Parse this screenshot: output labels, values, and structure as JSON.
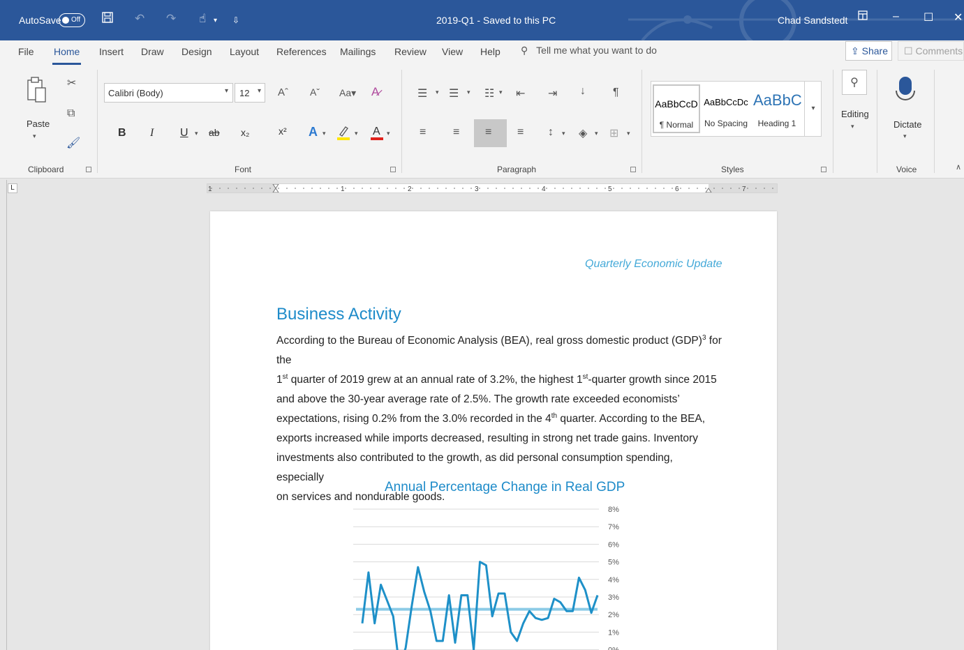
{
  "titlebar": {
    "autosave_label": "AutoSave",
    "autosave_state": "Off",
    "doc_title": "2019-Q1 - Saved to this PC",
    "user_name": "Chad Sandstedt",
    "icons": [
      "save-icon",
      "undo-icon",
      "redo-icon",
      "touch-mode-icon",
      "customize-qat-icon",
      "ribbon-display-icon",
      "minimize-icon",
      "restore-icon",
      "close-icon"
    ]
  },
  "tabs": [
    "File",
    "Home",
    "Insert",
    "Draw",
    "Design",
    "Layout",
    "References",
    "Mailings",
    "Review",
    "View",
    "Help"
  ],
  "active_tab": "Home",
  "tellme": "Tell me what you want to do",
  "share_label": "Share",
  "comments_label": "Comments",
  "ribbon": {
    "clipboard": {
      "label": "Clipboard",
      "paste_label": "Paste"
    },
    "font": {
      "label": "Font",
      "font_name": "Calibri (Body)",
      "font_size": "12",
      "change_case": "Aa"
    },
    "paragraph": {
      "label": "Paragraph"
    },
    "styles": {
      "label": "Styles",
      "items": [
        {
          "preview": "AaBbCcD",
          "name": "¶ Normal"
        },
        {
          "preview": "AaBbCcDc",
          "name": "No Spacing"
        },
        {
          "preview": "AaBbC",
          "name": "Heading 1"
        }
      ]
    },
    "editing": {
      "label": "Editing"
    },
    "voice": {
      "label": "Voice",
      "dictate_label": "Dictate"
    }
  },
  "ruler": {
    "numbers": [
      "1",
      "1",
      "2",
      "3",
      "4",
      "5",
      "6",
      "7"
    ]
  },
  "document": {
    "header_text": "Quarterly Economic Update",
    "heading": "Business Activity",
    "lines": [
      [
        "According to the Bureau of Economic Analysis (BEA), real gross domestic product (GDP)",
        "3",
        " for the"
      ],
      [
        "1",
        "st",
        " quarter of 2019 grew at an annual rate of 3.2%, the highest 1",
        "st",
        "-quarter growth since 2015"
      ],
      [
        "and above the 30-year average rate of 2.5%. The growth rate exceeded economists’"
      ],
      [
        "expectations, rising 0.2% from the 3.0% recorded in the 4",
        "th",
        " quarter. According to the BEA,"
      ],
      [
        "exports increased while imports decreased, resulting in strong net trade gains. Inventory"
      ],
      [
        "investments also contributed to the growth, as did personal consumption spending, especially"
      ],
      [
        "on services and nondurable goods."
      ]
    ],
    "chart_title": "Annual Percentage Change in Real GDP"
  },
  "chart_data": {
    "type": "line",
    "title": "Annual Percentage Change in Real GDP",
    "y_ticks": [
      "8%",
      "7%",
      "6%",
      "5%",
      "4%",
      "3%",
      "2%",
      "1%",
      "0%"
    ],
    "ylim": [
      0,
      8
    ],
    "series": [
      {
        "values": [
          1.5,
          4.4,
          1.5,
          3.7,
          2.8,
          1.9,
          -1.0,
          0.1,
          2.5,
          4.7,
          3.3,
          2.2,
          0.5,
          0.5,
          3.1,
          0.4,
          3.1,
          3.1,
          0.0,
          5.0,
          4.8,
          1.9,
          3.2,
          3.2,
          1.0,
          0.5,
          1.5,
          2.2,
          1.8,
          1.7,
          1.8,
          2.9,
          2.7,
          2.2,
          2.2,
          4.1,
          3.4,
          2.1,
          3.1
        ]
      },
      {
        "values": [
          2.3,
          2.3
        ]
      }
    ],
    "colors": {
      "line": "#1e90c8",
      "average": "#8ccbe6"
    }
  }
}
